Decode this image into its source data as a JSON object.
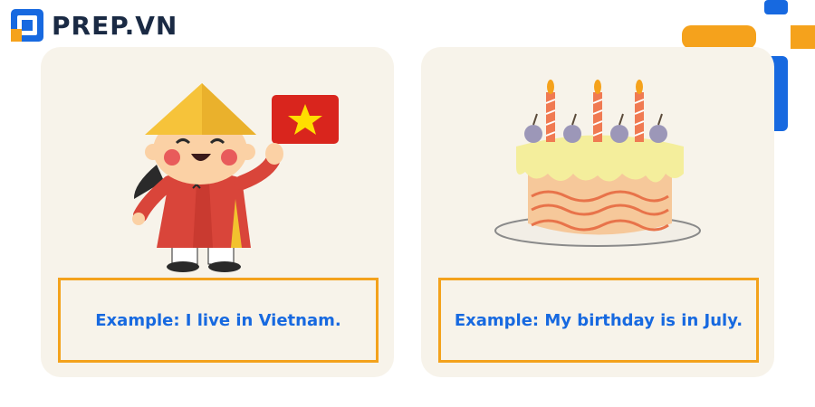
{
  "brand": {
    "name": "PREP.VN",
    "colors": {
      "blue": "#1769e0",
      "orange": "#f5a21c",
      "dark": "#1a2a44"
    }
  },
  "cards": [
    {
      "illustration": "girl-with-vietnam-flag",
      "caption": "Example: I live in Vietnam."
    },
    {
      "illustration": "birthday-cake-with-candles",
      "caption": "Example: My birthday is in July."
    }
  ]
}
